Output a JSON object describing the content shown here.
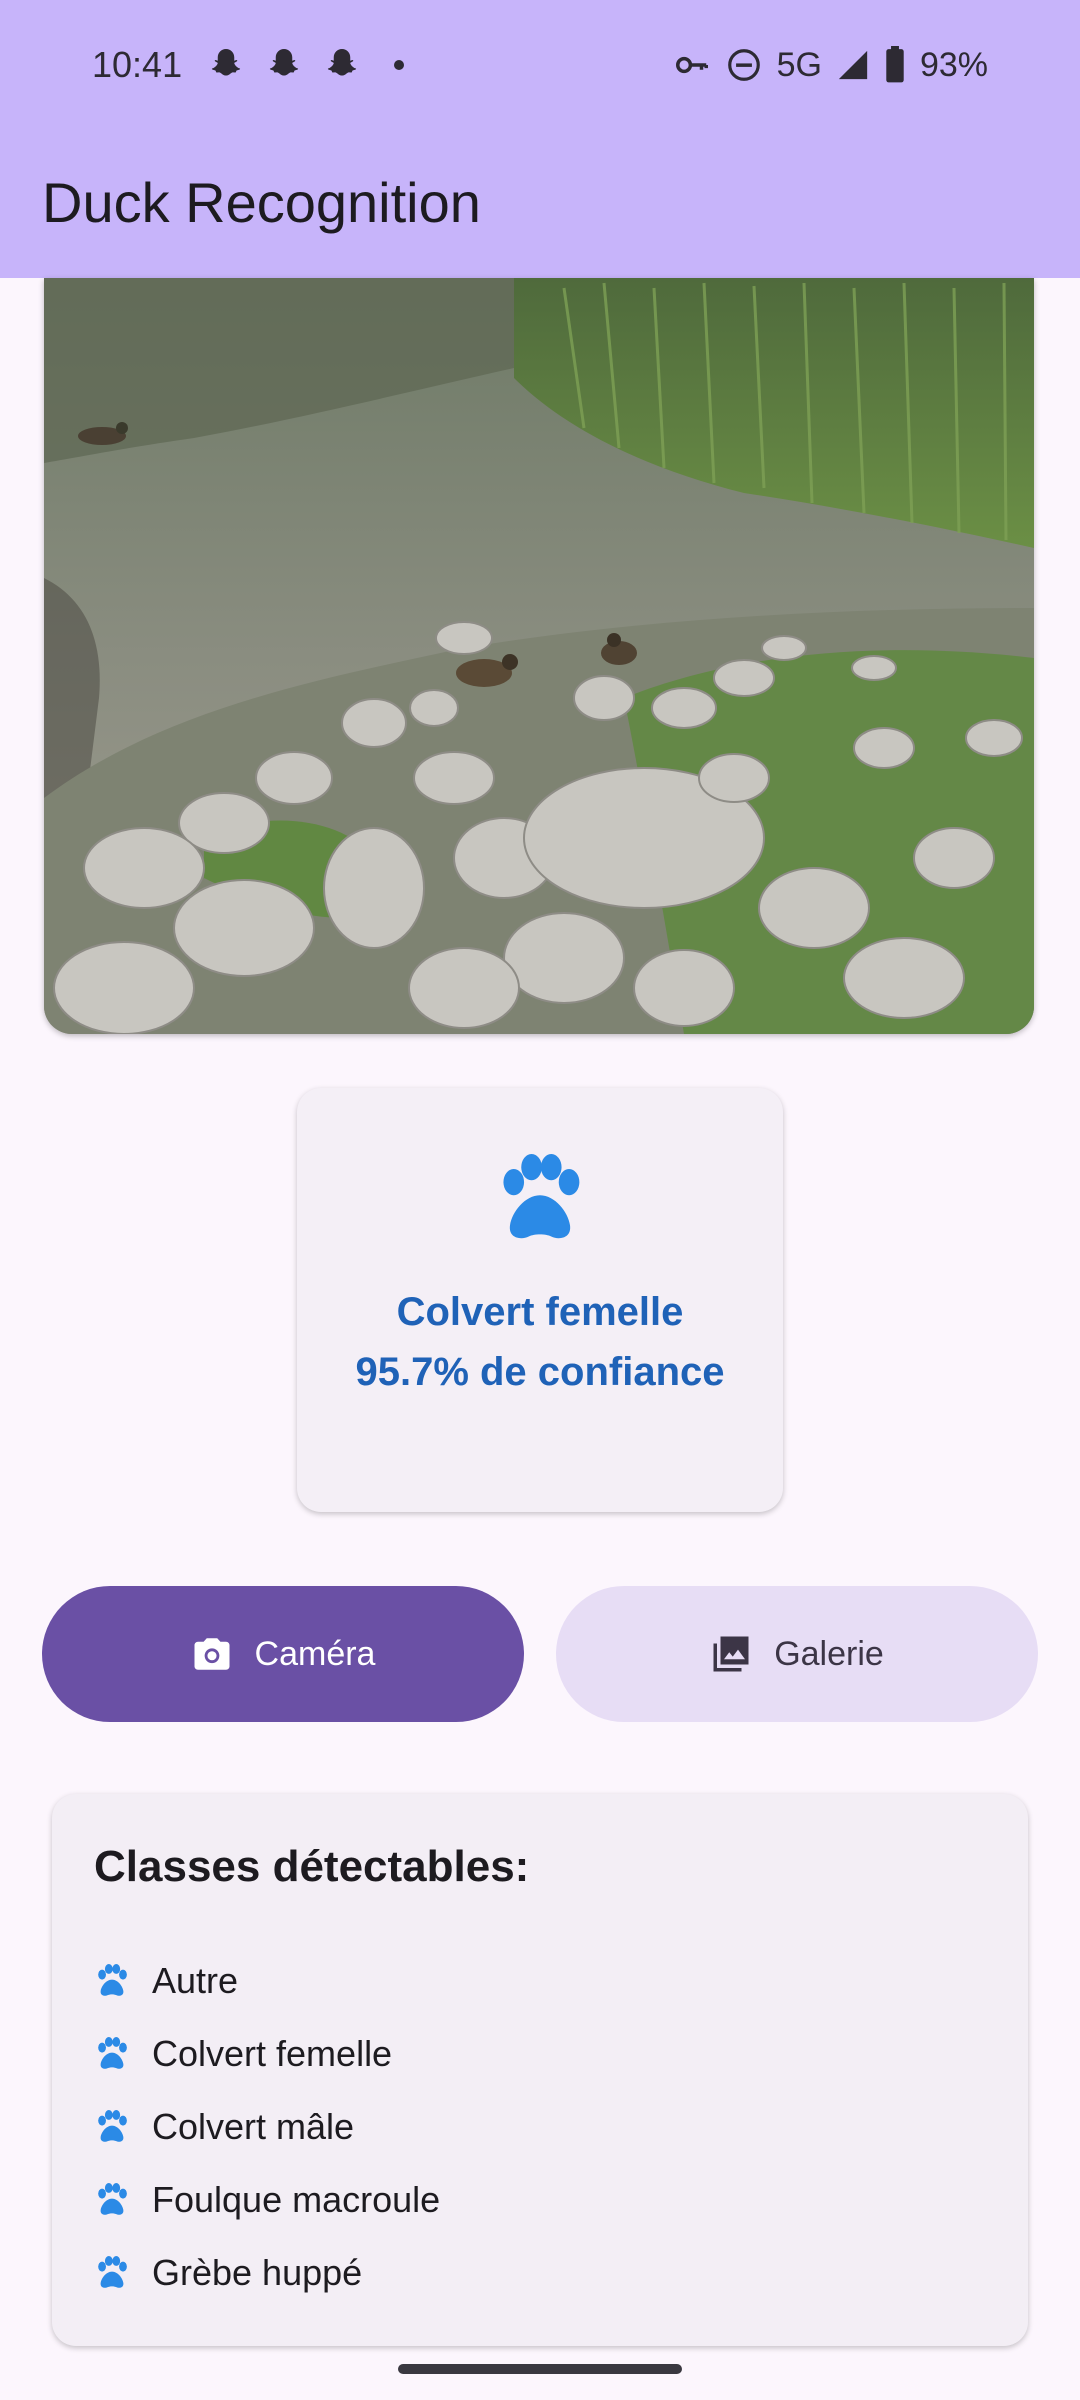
{
  "status_bar": {
    "time": "10:41",
    "notification_icons": [
      "snapchat-icon",
      "snapchat-icon",
      "snapchat-icon"
    ],
    "network": "5G",
    "battery": "93%"
  },
  "app_bar": {
    "title": "Duck Recognition"
  },
  "image": {
    "description_icon": "photo"
  },
  "result": {
    "icon": "paw-icon",
    "label": "Colvert femelle",
    "confidence": "95.7% de confiance",
    "color": "#1f62b7"
  },
  "actions": {
    "camera_label": "Caméra",
    "gallery_label": "Galerie"
  },
  "classes": {
    "title": "Classes détectables:",
    "items": [
      {
        "label": "Autre"
      },
      {
        "label": "Colvert femelle"
      },
      {
        "label": "Colvert mâle"
      },
      {
        "label": "Foulque macroule"
      },
      {
        "label": "Grèbe huppé"
      }
    ]
  },
  "colors": {
    "app_bar": "#c7b4fa",
    "primary_button": "#6a50a5",
    "tonal_button": "#e7ddf5",
    "accent_icon": "#2b8ae6"
  }
}
